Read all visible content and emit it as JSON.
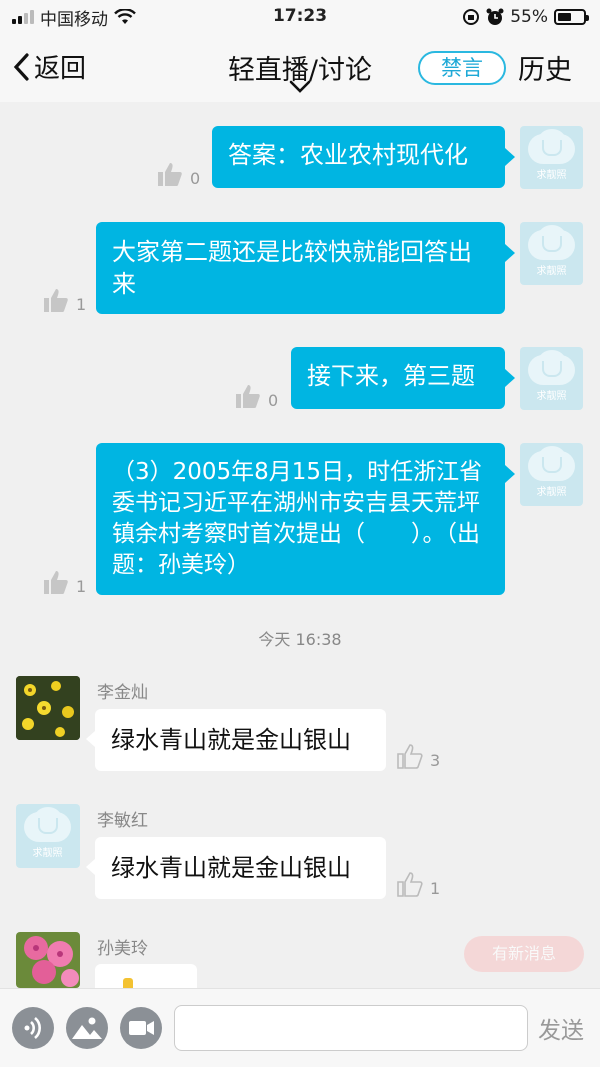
{
  "status_bar": {
    "carrier": "中国移动",
    "time": "17:23",
    "battery": "55%"
  },
  "nav": {
    "back_label": "返回",
    "title": "轻直播/讨论",
    "mute_label": "禁言",
    "history_label": "历史"
  },
  "messages_out": [
    {
      "text": "答案：农业农村现代化",
      "likes": "0",
      "avatar_label": "求靓照"
    },
    {
      "text": "大家第二题还是比较快就能回答出来",
      "likes": "1",
      "avatar_label": "求靓照"
    },
    {
      "text": "接下来，第三题",
      "likes": "0",
      "avatar_label": "求靓照"
    },
    {
      "text": "（3）2005年8月15日，时任浙江省委书记习近平在湖州市安吉县天荒坪镇余村考察时首次提出（　　）。（出题：孙美玲）",
      "likes": "1",
      "avatar_label": "求靓照"
    }
  ],
  "timestamp": "今天 16:38",
  "messages_in": [
    {
      "sender": "李金灿",
      "text": "绿水青山就是金山银山",
      "likes": "3"
    },
    {
      "sender": "李敏红",
      "text": "绿水青山就是金山银山",
      "likes": "1",
      "avatar_label": "求靓照"
    },
    {
      "sender": "孙美玲"
    }
  ],
  "new_messages_label": "有新消息",
  "input_bar": {
    "send_label": "发送"
  },
  "colors": {
    "accent": "#00b5e2",
    "mute_border": "#2ab8e0"
  }
}
